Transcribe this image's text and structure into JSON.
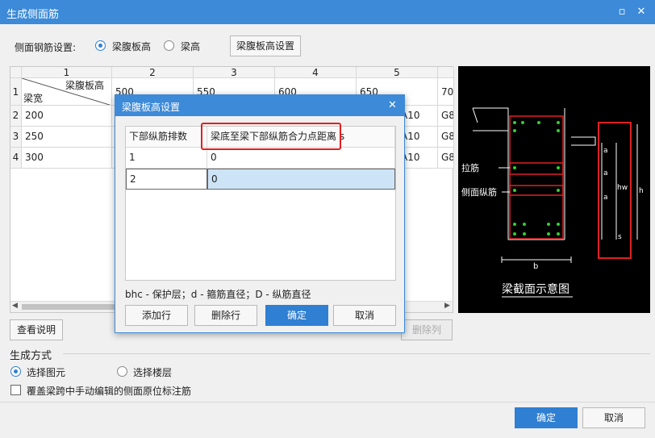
{
  "window": {
    "title": "生成侧面筋",
    "restore_glyph": "▫",
    "close_glyph": "✕"
  },
  "settings": {
    "label": "侧面钢筋设置:",
    "radio_web": "梁腹板高",
    "radio_height": "梁高",
    "btn_web_settings": "梁腹板高设置"
  },
  "grid": {
    "col_headers": [
      "1",
      "2",
      "3",
      "4",
      "5"
    ],
    "corner_top": "梁腹板高",
    "corner_bottom": "梁宽",
    "row_headers": [
      "1",
      "2",
      "3",
      "4"
    ],
    "row1": [
      "500",
      "550",
      "600",
      "650",
      "70"
    ],
    "rows": [
      {
        "width": "200",
        "c5": "A10",
        "c6": "G8"
      },
      {
        "width": "250",
        "c5": "A10",
        "c6": "G8"
      },
      {
        "width": "300",
        "c5": "A10",
        "c6": "G8"
      }
    ]
  },
  "buttons_below": {
    "view_help": "查看说明",
    "delete_col": "删除列"
  },
  "generate": {
    "title": "生成方式",
    "radio_select_element": "选择图元",
    "radio_select_floor": "选择楼层",
    "checkbox_override": "覆盖梁跨中手动编辑的侧面原位标注筋"
  },
  "footer": {
    "ok": "确定",
    "cancel": "取消"
  },
  "dialog": {
    "title": "梁腹板高设置",
    "close_glyph": "✕",
    "col1": "下部纵筋排数",
    "col2": "梁底至梁下部纵筋合力点距离 s",
    "rows": [
      {
        "rows_count": "1",
        "distance": "0"
      },
      {
        "rows_count": "2",
        "distance": "0"
      }
    ],
    "legend": "bhc - 保护层；d - 箍筋直径；D - 纵筋直径",
    "add_row": "添加行",
    "delete_row": "删除行",
    "ok": "确定",
    "cancel": "取消",
    "highlight_color": "#e02020"
  },
  "diagram": {
    "label_tie": "拉筋",
    "label_side_bar": "侧面纵筋",
    "caption": "梁截面示意图",
    "dim_a": "a",
    "dim_hw": "hw",
    "dim_h": "h",
    "dim_s": "s",
    "dim_b": "b"
  }
}
